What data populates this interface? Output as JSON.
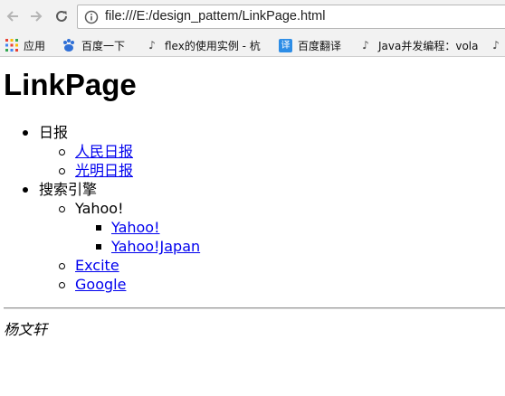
{
  "browser": {
    "url": "file:///E:/design_pattem/LinkPage.html",
    "bookmarks": [
      {
        "label": "应用",
        "icon": "apps-grid-icon"
      },
      {
        "label": "百度一下",
        "icon": "baidu-paw-icon"
      },
      {
        "label": "flex的使用实例 - 杭",
        "icon": "bookmark-site-icon"
      },
      {
        "label": "百度翻译",
        "icon": "translate-icon"
      },
      {
        "label": "Java并发编程：vola",
        "icon": "bookmark-site-icon"
      }
    ]
  },
  "page": {
    "title": "LinkPage",
    "trays": [
      {
        "caption": "日报",
        "links": [
          "人民日报",
          "光明日报"
        ]
      },
      {
        "caption": "搜索引擎",
        "subtray": {
          "caption": "Yahoo!",
          "links": [
            "Yahoo!",
            "Yahoo!Japan"
          ]
        },
        "links": [
          "Excite",
          "Google"
        ]
      }
    ],
    "author": "杨文轩"
  }
}
